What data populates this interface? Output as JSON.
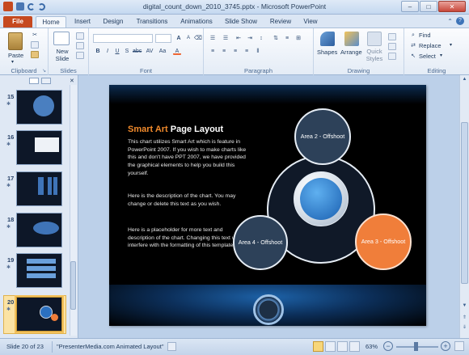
{
  "window": {
    "title": "digital_count_down_2010_3745.pptx - Microsoft PowerPoint",
    "minimize": "–",
    "maximize": "□",
    "close": "✕"
  },
  "tabs": [
    {
      "label": "File"
    },
    {
      "label": "Home"
    },
    {
      "label": "Insert"
    },
    {
      "label": "Design"
    },
    {
      "label": "Transitions"
    },
    {
      "label": "Animations"
    },
    {
      "label": "Slide Show"
    },
    {
      "label": "Review"
    },
    {
      "label": "View"
    }
  ],
  "ribbon": {
    "groups": {
      "clipboard": "Clipboard",
      "slides": "Slides",
      "font": "Font",
      "paragraph": "Paragraph",
      "drawing": "Drawing",
      "editing": "Editing"
    },
    "paste": "Paste",
    "new_slide": "New Slide",
    "shapes": "Shapes",
    "arrange": "Arrange",
    "quick_styles": "Quick Styles",
    "find": "Find",
    "replace": "Replace",
    "select": "Select"
  },
  "slides_pane": {
    "numbers": [
      "15",
      "16",
      "17",
      "18",
      "19",
      "20"
    ],
    "selected": "20"
  },
  "slide": {
    "title_accent": "Smart Art",
    "title_rest": " Page Layout",
    "para1": "This chart utilizes Smart Art which is feature in PowerPoint 2007.  If you wish to make charts like this and don't have PPT 2007, we have provided the graphical elements to help you build this yourself.",
    "para2": "Here is the description of the chart.  You may change or delete this text as you wish.",
    "para3": "Here is a placeholder for more text and description of the chart.  Changing this text will not interfere with the formatting of this template.",
    "area2": "Area 2 - Offshoot",
    "area3": "Area 3 - Offshoot",
    "area4": "Area 4 - Offshoot"
  },
  "status": {
    "slide": "Slide 20 of 23",
    "theme": "\"PresenterMedia.com Animated Layout\"",
    "zoom": "63%"
  },
  "colors": {
    "accent_orange": "#f08a2c",
    "file_tab": "#c6491f",
    "circle_fill": "#2d4159",
    "circle_orange": "#f07e3a"
  }
}
